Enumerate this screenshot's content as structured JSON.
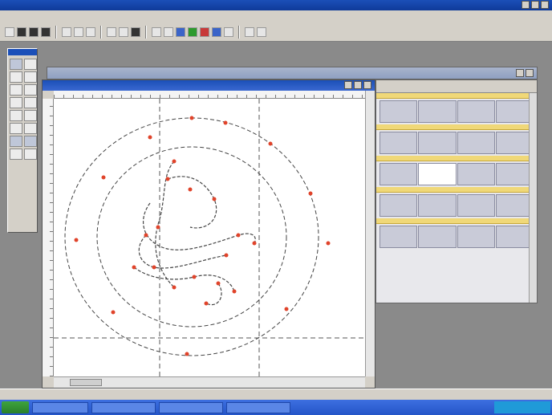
{
  "app": {
    "title": "",
    "tray_text": ""
  },
  "menu": {
    "items": [
      "",
      "",
      "",
      "",
      "",
      "",
      ""
    ]
  },
  "colors": {
    "accent": "#1b4fb8",
    "node": "#e0432a",
    "path": "#444444",
    "guide": "#555555",
    "palette_header": "#f0d878",
    "taskbar": "#2455c8"
  },
  "icons": {
    "toolbar": [
      "new-icon",
      "open-icon",
      "save-icon",
      "print-icon",
      "cut-icon",
      "copy-icon",
      "paste-icon",
      "undo-icon",
      "redo-icon",
      "zoom-icon",
      "grid-icon",
      "snap-icon",
      "color-icon",
      "align-icon"
    ],
    "tools": [
      "select-icon",
      "node-icon",
      "pen-icon",
      "bezier-icon",
      "rectangle-icon",
      "ellipse-icon",
      "text-icon",
      "fill-icon",
      "zoom-tool-icon",
      "hand-icon",
      "eyedropper-icon",
      "knife-icon"
    ]
  },
  "document": {
    "title": ""
  },
  "statusbar": {
    "text": "",
    "right": ""
  },
  "taskbar": {
    "start": "",
    "items": [
      "",
      "",
      "",
      ""
    ]
  }
}
